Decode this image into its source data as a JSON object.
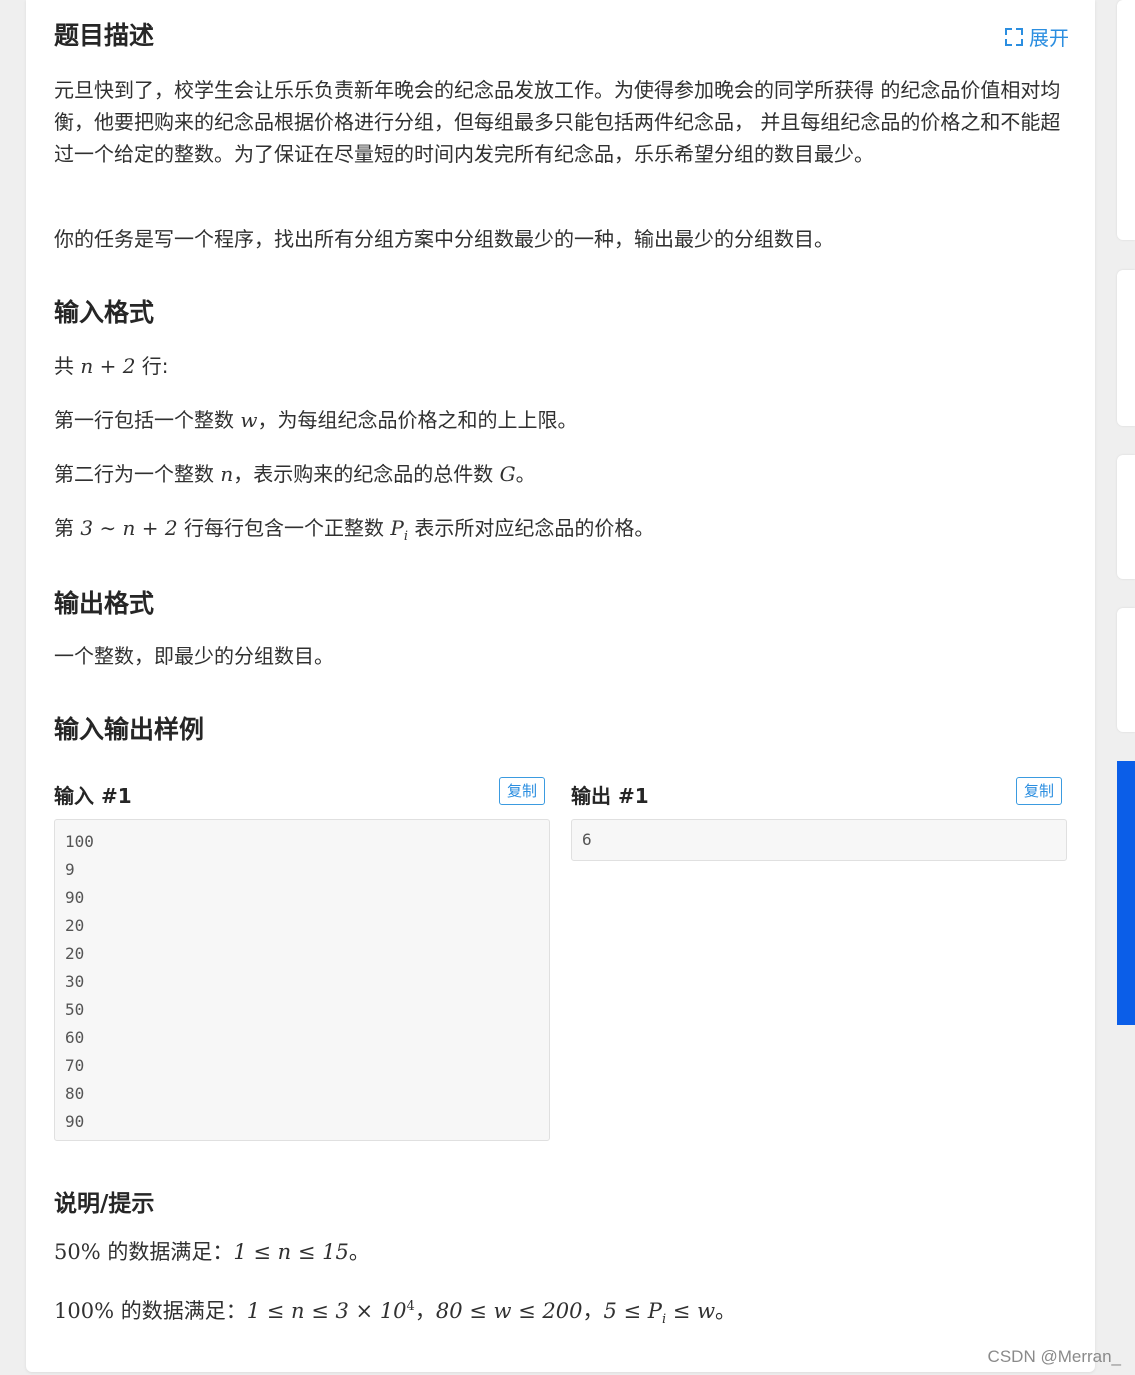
{
  "header": {
    "title": "题目描述",
    "expand_label": "展开"
  },
  "description": {
    "p1": "元旦快到了，校学生会让乐乐负责新年晚会的纪念品发放工作。为使得参加晚会的同学所获得 的纪念品价值相对均衡，他要把购来的纪念品根据价格进行分组，但每组最多只能包括两件纪念品， 并且每组纪念品的价格之和不能超过一个给定的整数。为了保证在尽量短的时间内发完所有纪念品，乐乐希望分组的数目最少。",
    "p2": "你的任务是写一个程序，找出所有分组方案中分组数最少的一种，输出最少的分组数目。"
  },
  "input_format": {
    "title": "输入格式",
    "l1_pre": "共",
    "l1_math": "n + 2",
    "l1_post": "行:",
    "l2_pre": "第一行包括一个整数",
    "l2_math": "w",
    "l2_post": "，为每组纪念品价格之和的上上限。",
    "l3_pre": "第二行为一个整数",
    "l3_math1": "n",
    "l3_mid": "，表示购来的纪念品的总件数",
    "l3_math2": "G",
    "l3_post": "。",
    "l4_pre": "第",
    "l4_math": "3 ∼ n + 2",
    "l4_mid": "行每行包含一个正整数",
    "l4_math2": "P",
    "l4_sub": "i",
    "l4_post": "表示所对应纪念品的价格。"
  },
  "output_format": {
    "title": "输出格式",
    "text": "一个整数，即最少的分组数目。"
  },
  "samples": {
    "title": "输入输出样例",
    "input_label": "输入 #1",
    "output_label": "输出 #1",
    "copy_label": "复制",
    "input_lines": [
      "100",
      "9",
      "90",
      "20",
      "20",
      "30",
      "50",
      "60",
      "70",
      "80",
      "90"
    ],
    "output_lines": [
      "6"
    ]
  },
  "hint": {
    "title": "说明/提示",
    "l1_pct": "50%",
    "l1_text": "的数据满足：",
    "l1_math": "1 ≤ n ≤ 15",
    "l1_end": "。",
    "l2_pct": "100%",
    "l2_text": "的数据满足：",
    "l2_m1": "1 ≤ n ≤ 3 × 10",
    "l2_sup": "4",
    "l2_sep1": "，",
    "l2_m2": "80 ≤ w ≤ 200",
    "l2_sep2": "，",
    "l2_m3": "5 ≤ P",
    "l2_sub": "i",
    "l2_m3b": "≤ w",
    "l2_end": "。"
  },
  "watermark": "CSDN @Merran_"
}
